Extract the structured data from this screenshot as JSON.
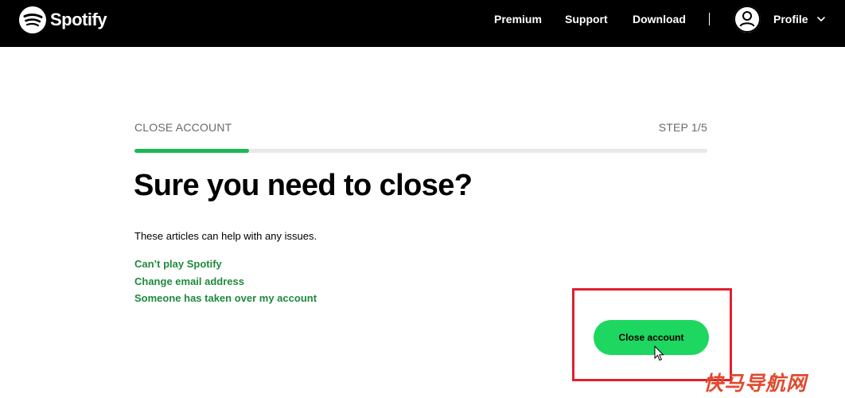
{
  "header": {
    "brand": "Spotify",
    "nav": [
      {
        "label": "Premium"
      },
      {
        "label": "Support"
      },
      {
        "label": "Download"
      }
    ],
    "profile_label": "Profile"
  },
  "close_account": {
    "section_label": "CLOSE ACCOUNT",
    "step_label": "STEP 1/5",
    "progress": 0.2,
    "heading": "Sure you need to close?",
    "help_text": "These articles can help with any issues.",
    "links": [
      {
        "label": "Can’t play Spotify"
      },
      {
        "label": "Change email address"
      },
      {
        "label": "Someone has taken over my account"
      }
    ],
    "button_label": "Close account"
  },
  "annotation": {
    "highlight_color": "#e0202e"
  },
  "watermark": "快马导航网",
  "colors": {
    "brand_green": "#1ed760",
    "link_green": "#1e8a3c",
    "header_bg": "#000000"
  }
}
